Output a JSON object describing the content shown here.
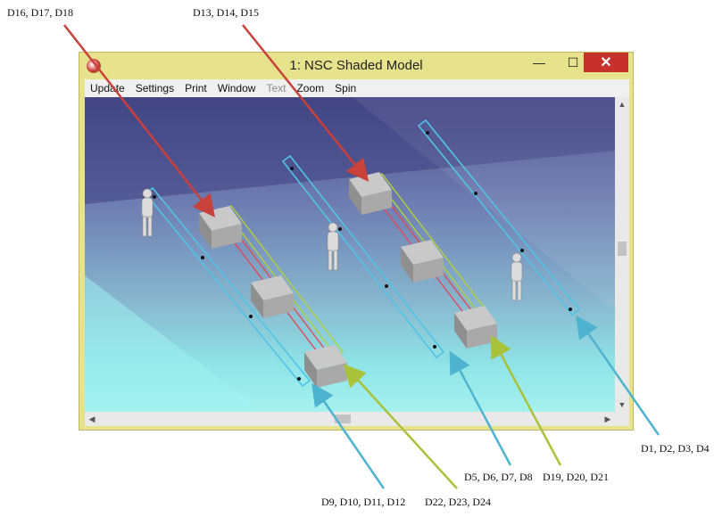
{
  "window": {
    "title": "1: NSC Shaded Model",
    "controls": {
      "minimize": "—",
      "maximize": "☐",
      "close": "✕"
    }
  },
  "menu": [
    {
      "label": "Update",
      "enabled": true
    },
    {
      "label": "Settings",
      "enabled": true
    },
    {
      "label": "Print",
      "enabled": true
    },
    {
      "label": "Window",
      "enabled": true
    },
    {
      "label": "Text",
      "enabled": false
    },
    {
      "label": "Zoom",
      "enabled": true
    },
    {
      "label": "Spin",
      "enabled": true
    }
  ],
  "annotations": {
    "d16_d18": "D16, D17, D18",
    "d13_d15": "D13, D14, D15",
    "d1_d4": "D1, D2, D3, D4",
    "d5_d8": "D5, D6, D7, D8",
    "d19_d21": "D19, D20, D21",
    "d9_d12": "D9, D10, D11, D12",
    "d22_d24": "D22, D23, D24"
  },
  "colors": {
    "red_arrow": "#c8413a",
    "blue_arrow": "#4db3cf",
    "green_arrow": "#a9c23a",
    "window_frame": "#e6e38c",
    "close_button": "#c7312b"
  },
  "icons": {
    "app": "zemax-app-icon",
    "scroll_up": "triangle-up-icon",
    "scroll_down": "triangle-down-icon",
    "scroll_left": "triangle-left-icon",
    "scroll_right": "triangle-right-icon"
  }
}
